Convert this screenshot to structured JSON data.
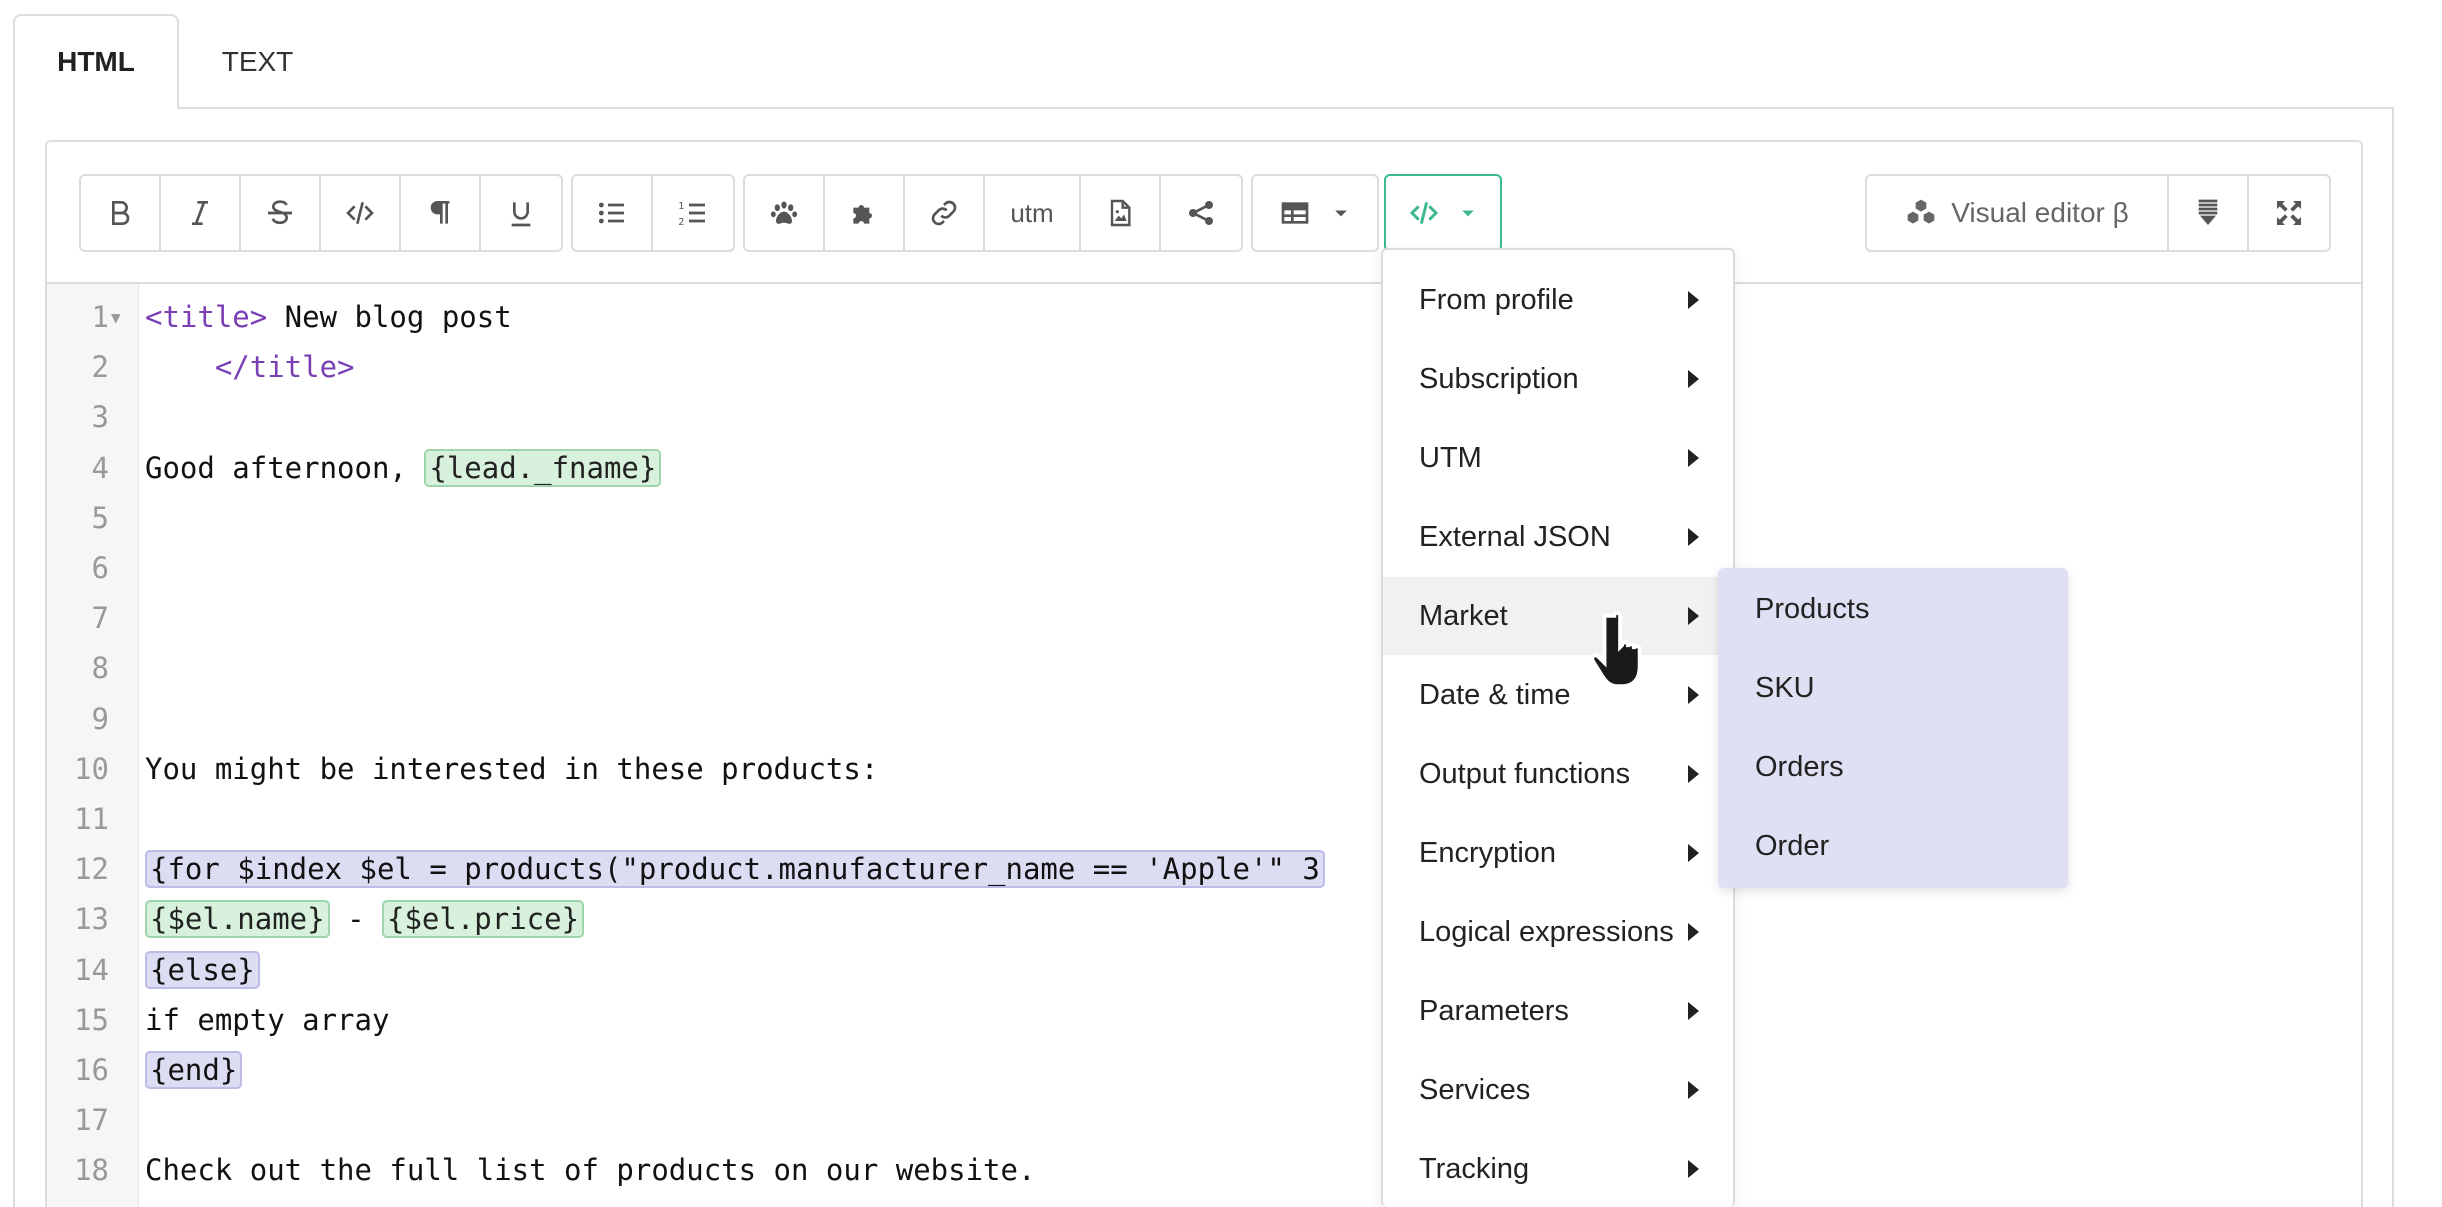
{
  "tabs": [
    {
      "label": "HTML",
      "active": true
    },
    {
      "label": "TEXT",
      "active": false
    }
  ],
  "toolbar": {
    "format_buttons": [
      "bold-icon",
      "italic-icon",
      "strikethrough-icon",
      "code-icon",
      "paragraph-icon",
      "underline-icon"
    ],
    "list_buttons": [
      "bulleted-list-icon",
      "numbered-list-icon"
    ],
    "insert_buttons": [
      "paw-icon",
      "puzzle-icon",
      "link-icon",
      "utm",
      "image-file-icon",
      "share-icon"
    ],
    "utm_label": "utm",
    "table_button": "table-icon",
    "code_insert_button": "code-icon",
    "visual_editor_label": "Visual editor β",
    "accent_color": "#3cb88f"
  },
  "code_lines": [
    {
      "n": "1",
      "fold": true,
      "segments": [
        {
          "t": "<title>",
          "k": "tag"
        },
        {
          "t": " New blog post",
          "k": "text"
        }
      ]
    },
    {
      "n": "2",
      "segments": [
        {
          "t": "    ",
          "k": "text"
        },
        {
          "t": "</title>",
          "k": "tag"
        }
      ]
    },
    {
      "n": "3",
      "segments": []
    },
    {
      "n": "4",
      "segments": [
        {
          "t": "Good afternoon, ",
          "k": "text"
        },
        {
          "t": "{lead._fname}",
          "k": "green"
        }
      ]
    },
    {
      "n": "5",
      "segments": []
    },
    {
      "n": "6",
      "segments": []
    },
    {
      "n": "7",
      "segments": []
    },
    {
      "n": "8",
      "segments": []
    },
    {
      "n": "9",
      "segments": []
    },
    {
      "n": "10",
      "segments": [
        {
          "t": "You might be interested in these products:",
          "k": "text"
        }
      ]
    },
    {
      "n": "11",
      "segments": []
    },
    {
      "n": "12",
      "segments": [
        {
          "t": "{for $index $el = products(\"product.manufacturer_name == 'Apple'\" 3",
          "k": "purple"
        }
      ]
    },
    {
      "n": "13",
      "segments": [
        {
          "t": "{$el.name}",
          "k": "green"
        },
        {
          "t": " - ",
          "k": "text"
        },
        {
          "t": "{$el.price}",
          "k": "green"
        }
      ]
    },
    {
      "n": "14",
      "segments": [
        {
          "t": "{else}",
          "k": "purple"
        }
      ]
    },
    {
      "n": "15",
      "segments": [
        {
          "t": "if empty array",
          "k": "text"
        }
      ]
    },
    {
      "n": "16",
      "segments": [
        {
          "t": "{end}",
          "k": "purple"
        }
      ]
    },
    {
      "n": "17",
      "segments": []
    },
    {
      "n": "18",
      "segments": [
        {
          "t": "Check out the full list of products on our website.",
          "k": "text"
        }
      ]
    }
  ],
  "menu": {
    "items": [
      {
        "label": "From profile",
        "hover": false
      },
      {
        "label": "Subscription",
        "hover": false
      },
      {
        "label": "UTM",
        "hover": false
      },
      {
        "label": "External JSON",
        "hover": false
      },
      {
        "label": "Market",
        "hover": true
      },
      {
        "label": "Date & time",
        "hover": false
      },
      {
        "label": "Output functions",
        "hover": false
      },
      {
        "label": "Encryption",
        "hover": false
      },
      {
        "label": "Logical expressions",
        "hover": false
      },
      {
        "label": "Parameters",
        "hover": false
      },
      {
        "label": "Services",
        "hover": false
      },
      {
        "label": "Tracking",
        "hover": false
      }
    ]
  },
  "submenu": {
    "items": [
      "Products",
      "SKU",
      "Orders",
      "Order"
    ]
  }
}
